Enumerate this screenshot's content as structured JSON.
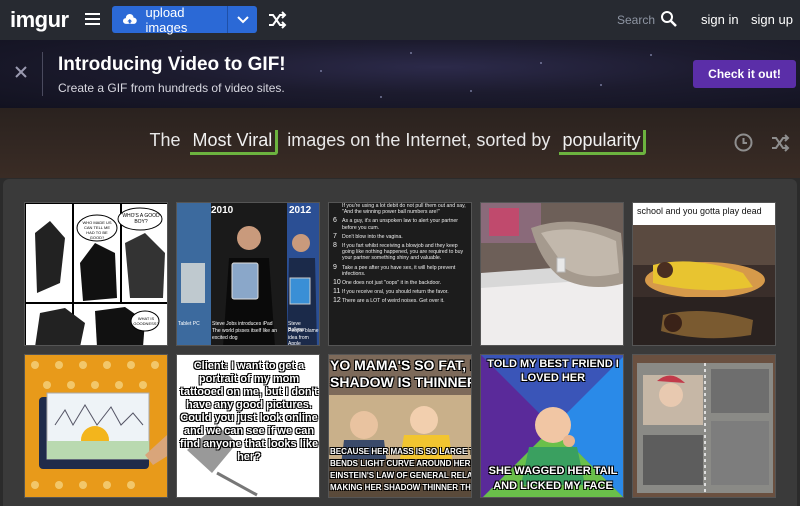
{
  "app": {
    "logo": "imgur",
    "upload_label": "upload images",
    "search_label": "Search",
    "sign_in": "sign in",
    "sign_up": "sign up"
  },
  "banner": {
    "title": "Introducing Video to GIF!",
    "subtitle": "Create a GIF from hundreds of video sites.",
    "cta": "Check it out!"
  },
  "headline": {
    "prefix": "The",
    "section": "Most Viral",
    "middle": "images on the Internet, sorted by",
    "sort": "popularity"
  },
  "colors": {
    "upload_blue": "#2b69d6",
    "cta_purple": "#5b2ea8",
    "select_green": "#6cb33f"
  },
  "tiles": [
    {
      "caption_top": "WHO'S A GOOD BOY?",
      "caption_mid": "WHO MADE US CAN TELL ME HAD TO BE GOOD?",
      "caption_q": "WHAT IS GOODNESS?",
      "icon": "comic-strip"
    },
    {
      "year_left": "2010",
      "year_right": "2012",
      "label_left": "Tablet PC",
      "caption_center_1": "Steve Jobs introduces iPad",
      "caption_center_2": "The world pisses itself like an",
      "caption_center_3": "excited dog",
      "caption_right_1": "Steve Ballmer",
      "caption_right_2": "People blame",
      "caption_right_3": "idea from Apple"
    },
    {
      "lines": [
        {
          "num": "",
          "text": "If you're using a lot debit do not pull them out and say, \"And the winning power ball numbers are!\""
        },
        {
          "num": "6",
          "text": "As a guy, it's an unspoken law to alert your partner before you cum."
        },
        {
          "num": "7",
          "text": "Don't blow into the vagina."
        },
        {
          "num": "8",
          "text": "If you fart whilst receiving a blowjob and they keep going like nothing happened, you are required to buy your partner something shiny and valuable."
        },
        {
          "num": "9",
          "text": "Take a pee after you have sex, it will help prevent infections."
        },
        {
          "num": "10",
          "text": "One does not just \"oops\" it in the backdoor."
        },
        {
          "num": "11",
          "text": "If you receive oral, you should return the favor."
        },
        {
          "num": "12",
          "text": "There are a LOT of weird noises. Get over it."
        }
      ]
    },
    {
      "icon": "cat-on-table"
    },
    {
      "caption": "school and you gotta play dead"
    },
    {
      "icon": "painted-flipbook"
    },
    {
      "text": "Client: I want to get a portrait of my mom tattooed on me, but I don't have any good pictures. Could you just look online and we can see if we can find anyone that looks like her?"
    },
    {
      "top": "YO MAMA'S SO FAT, HE",
      "top2": "SHADOW IS THINNER THA",
      "bottom1": "BECAUSE HER MASS IS SO LARGE THA",
      "bottom2": "BENDS LIGHT CURVE AROUND HER ACCO",
      "bottom3": "EINSTEIN'S LAW OF GENERAL RELATIV",
      "bottom4": "MAKING HER SHADOW THINNER TH"
    },
    {
      "top1": "TOLD MY BEST FRIEND I",
      "top2": "LOVED HER",
      "bottom1": "SHE WAGGED HER TAIL",
      "bottom2": "AND LICKED MY FACE"
    },
    {
      "icon": "photo-album"
    }
  ]
}
